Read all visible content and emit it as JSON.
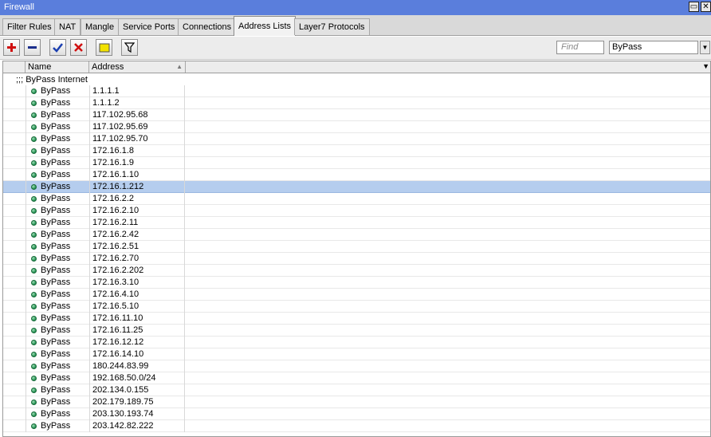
{
  "window": {
    "title": "Firewall",
    "restore_icon": "restore-icon",
    "close_icon": "close-icon",
    "close_glyph": "✕",
    "restore_glyph": "▭"
  },
  "tabs": [
    {
      "label": "Filter Rules",
      "active": false
    },
    {
      "label": "NAT",
      "active": false
    },
    {
      "label": "Mangle",
      "active": false
    },
    {
      "label": "Service Ports",
      "active": false
    },
    {
      "label": "Connections",
      "active": false
    },
    {
      "label": "Address Lists",
      "active": true
    },
    {
      "label": "Layer7 Protocols",
      "active": false
    }
  ],
  "toolbar": {
    "buttons": [
      {
        "name": "add-button",
        "icon": "plus-icon",
        "color": "#d01010"
      },
      {
        "name": "remove-button",
        "icon": "minus-icon",
        "color": "#1b2f8c"
      },
      {
        "name": "enable-button",
        "icon": "check-icon",
        "color": "#1b3fb0"
      },
      {
        "name": "disable-button",
        "icon": "x-icon",
        "color": "#d01010"
      },
      {
        "name": "comment-button",
        "icon": "note-icon",
        "color": "#f2e200"
      },
      {
        "name": "filter-button",
        "icon": "filter-icon",
        "color": "#000000"
      }
    ],
    "find_placeholder": "Find",
    "list_filter_value": "ByPass"
  },
  "table": {
    "columns": [
      "Name",
      "Address"
    ],
    "comment": ";;; ByPass Internet",
    "selected_color": "#b5cdee",
    "rows": [
      {
        "name": "ByPass",
        "address": "1.1.1.1"
      },
      {
        "name": "ByPass",
        "address": "1.1.1.2"
      },
      {
        "name": "ByPass",
        "address": "117.102.95.68"
      },
      {
        "name": "ByPass",
        "address": "117.102.95.69"
      },
      {
        "name": "ByPass",
        "address": "117.102.95.70"
      },
      {
        "name": "ByPass",
        "address": "172.16.1.8"
      },
      {
        "name": "ByPass",
        "address": "172.16.1.9"
      },
      {
        "name": "ByPass",
        "address": "172.16.1.10"
      },
      {
        "name": "ByPass",
        "address": "172.16.1.212",
        "selected": true
      },
      {
        "name": "ByPass",
        "address": "172.16.2.2"
      },
      {
        "name": "ByPass",
        "address": "172.16.2.10"
      },
      {
        "name": "ByPass",
        "address": "172.16.2.11"
      },
      {
        "name": "ByPass",
        "address": "172.16.2.42"
      },
      {
        "name": "ByPass",
        "address": "172.16.2.51"
      },
      {
        "name": "ByPass",
        "address": "172.16.2.70"
      },
      {
        "name": "ByPass",
        "address": "172.16.2.202"
      },
      {
        "name": "ByPass",
        "address": "172.16.3.10"
      },
      {
        "name": "ByPass",
        "address": "172.16.4.10"
      },
      {
        "name": "ByPass",
        "address": "172.16.5.10"
      },
      {
        "name": "ByPass",
        "address": "172.16.11.10"
      },
      {
        "name": "ByPass",
        "address": "172.16.11.25"
      },
      {
        "name": "ByPass",
        "address": "172.16.12.12"
      },
      {
        "name": "ByPass",
        "address": "172.16.14.10"
      },
      {
        "name": "ByPass",
        "address": "180.244.83.99"
      },
      {
        "name": "ByPass",
        "address": "192.168.50.0/24"
      },
      {
        "name": "ByPass",
        "address": "202.134.0.155"
      },
      {
        "name": "ByPass",
        "address": "202.179.189.75"
      },
      {
        "name": "ByPass",
        "address": "203.130.193.74"
      },
      {
        "name": "ByPass",
        "address": "203.142.82.222"
      }
    ]
  }
}
